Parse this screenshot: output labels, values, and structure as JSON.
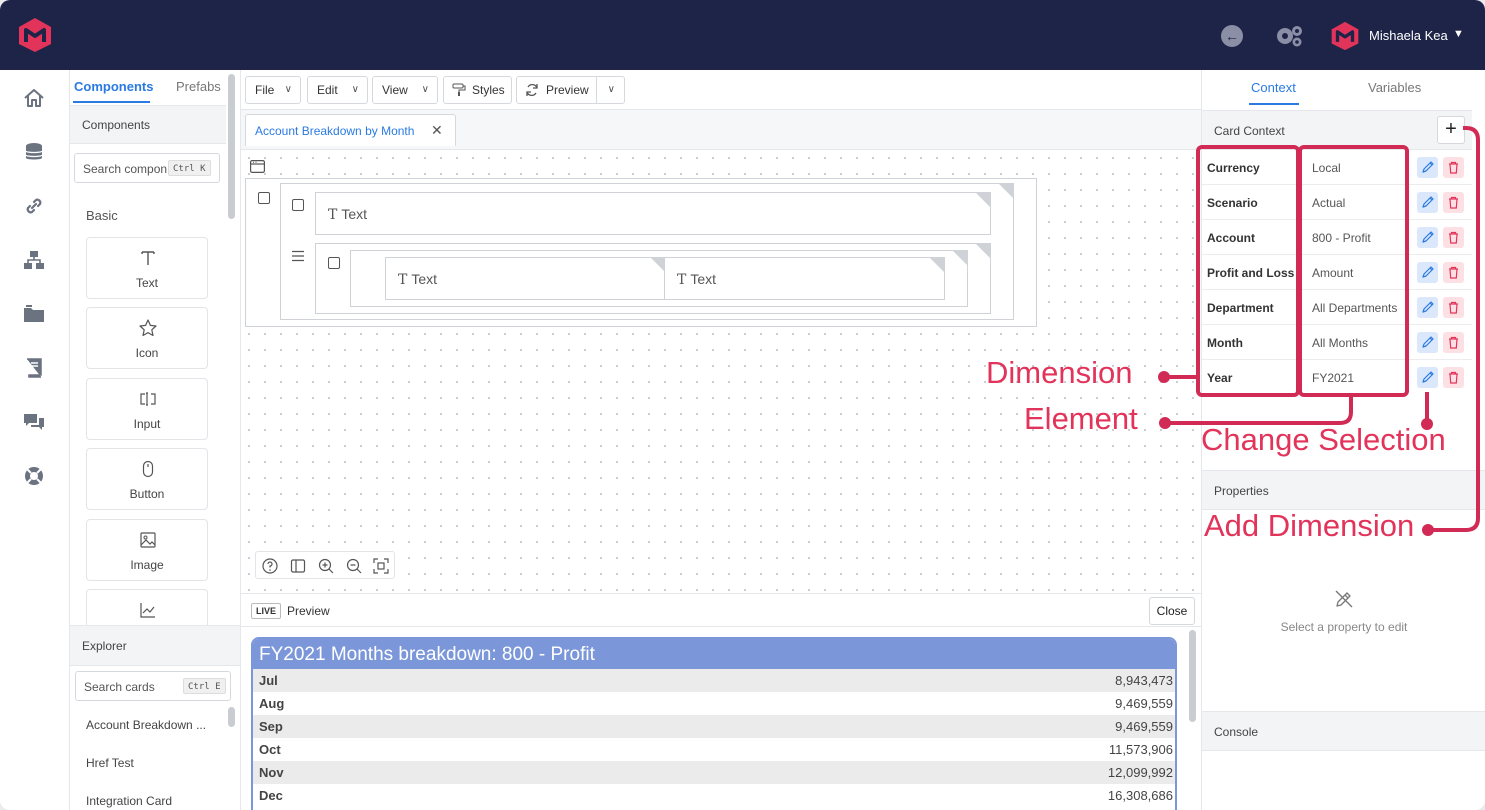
{
  "header": {
    "user_name": "Mishaela Kea",
    "icons": [
      "logo-icon",
      "back-icon",
      "settings-icon",
      "avatar-icon",
      "chevron-down-icon"
    ]
  },
  "rail": {
    "icons": [
      "home-icon",
      "database-icon",
      "link-icon",
      "sitemap-icon",
      "folder-icon",
      "book-icon",
      "chat-icon",
      "lifebuoy-icon"
    ]
  },
  "components_panel": {
    "tabs": [
      "Components",
      "Prefabs"
    ],
    "section_title": "Components",
    "search_placeholder": "Search components",
    "search_shortcut": "Ctrl K",
    "group_label": "Basic",
    "items": [
      "Text",
      "Icon",
      "Input",
      "Button",
      "Image"
    ]
  },
  "explorer": {
    "title": "Explorer",
    "search_placeholder": "Search cards",
    "search_shortcut": "Ctrl E",
    "items": [
      "Account Breakdown ...",
      "Href Test",
      "Integration Card"
    ]
  },
  "toolbar": {
    "file": "File",
    "edit": "Edit",
    "view": "View",
    "styles": "Styles",
    "preview": "Preview"
  },
  "doc_tab": {
    "title": "Account Breakdown by Month"
  },
  "canvas": {
    "text_1": "Text",
    "text_2": "Text",
    "text_3": "Text"
  },
  "preview": {
    "badge": "LIVE",
    "label": "Preview",
    "close": "Close",
    "card_title": "FY2021 Months breakdown: 800 - Profit",
    "rows": [
      {
        "month": "Jul",
        "value": "8,943,473"
      },
      {
        "month": "Aug",
        "value": "9,469,559"
      },
      {
        "month": "Sep",
        "value": "9,469,559"
      },
      {
        "month": "Oct",
        "value": "11,573,906"
      },
      {
        "month": "Nov",
        "value": "12,099,992"
      },
      {
        "month": "Dec",
        "value": "16,308,686"
      }
    ]
  },
  "right_panel": {
    "tabs": [
      "Context",
      "Variables"
    ],
    "card_context_title": "Card Context",
    "add_label": "+",
    "context": [
      {
        "dimension": "Currency",
        "element": "Local"
      },
      {
        "dimension": "Scenario",
        "element": "Actual"
      },
      {
        "dimension": "Account",
        "element": "800 - Profit"
      },
      {
        "dimension": "Profit and Loss ...",
        "element": "Amount"
      },
      {
        "dimension": "Department",
        "element": "All Departments"
      },
      {
        "dimension": "Month",
        "element": "All Months"
      },
      {
        "dimension": "Year",
        "element": "FY2021"
      }
    ],
    "properties_title": "Properties",
    "properties_empty": "Select a property to edit",
    "console_title": "Console"
  },
  "annotations": {
    "dimension": "Dimension",
    "element": "Element",
    "change_selection": "Change Selection",
    "add_dimension": "Add Dimension",
    "color": "#e2345a"
  }
}
